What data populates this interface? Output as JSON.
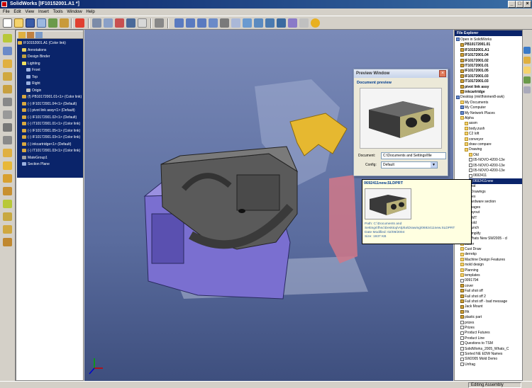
{
  "window": {
    "app_name": "SolidWorks",
    "document_title": "[IF10152001.A1 *]",
    "controls": {
      "minimize": "_",
      "maximize": "□",
      "close": "×"
    }
  },
  "menu": [
    "File",
    "Edit",
    "View",
    "Insert",
    "Tools",
    "Window",
    "Help"
  ],
  "feature_tree": {
    "items": [
      {
        "label": "IF10152001.A1 (Color link)",
        "icon": "assembly-icon",
        "indent": 0
      },
      {
        "label": "Annotations",
        "icon": "annotations-icon",
        "indent": 1
      },
      {
        "label": "Design Binder",
        "icon": "design-binder-icon",
        "indent": 1
      },
      {
        "label": "Lighting",
        "icon": "lighting-icon",
        "indent": 1
      },
      {
        "label": "Front",
        "icon": "plane-icon",
        "indent": 2
      },
      {
        "label": "Top",
        "icon": "plane-icon",
        "indent": 2
      },
      {
        "label": "Right",
        "icon": "plane-icon",
        "indent": 2
      },
      {
        "label": "Origin",
        "icon": "origin-icon",
        "indent": 2
      },
      {
        "label": "(f) PB10172001.01<1> (Color link)",
        "icon": "part-icon",
        "indent": 1
      },
      {
        "label": "(-) IF10172001.04<1> (Default)",
        "icon": "part-icon",
        "indent": 1
      },
      {
        "label": "(-) pivot link assy<1> (Default)",
        "icon": "part-icon",
        "indent": 1
      },
      {
        "label": "(-) IF10172001.02<1> (Default)",
        "icon": "part-icon",
        "indent": 1
      },
      {
        "label": "(-) IT10172001.01<1> (Color link)",
        "icon": "part-icon",
        "indent": 1
      },
      {
        "label": "(-) IF10172001.05<1> (Color link)",
        "icon": "part-icon",
        "indent": 1
      },
      {
        "label": "(-) IF10172001.03<1> (Color link)",
        "icon": "part-icon",
        "indent": 1
      },
      {
        "label": "(-) inkcartridge<1> (Default)",
        "icon": "part-icon",
        "indent": 1
      },
      {
        "label": "(-) IT10172001.03<1> (Color link)",
        "icon": "part-icon",
        "indent": 1
      },
      {
        "label": "MateGroup1",
        "icon": "mates-icon",
        "indent": 1
      },
      {
        "label": "Section Plane",
        "icon": "plane-icon",
        "indent": 1
      }
    ]
  },
  "file_explorer": {
    "title": "File Explorer",
    "items": [
      {
        "label": "Open in SolidWorks",
        "type": "sys",
        "indent": 0,
        "bold": false
      },
      {
        "label": "PB10172001.01",
        "type": "part",
        "indent": 1,
        "bold": true
      },
      {
        "label": "IF10152001.A1",
        "type": "part",
        "indent": 1,
        "bold": true
      },
      {
        "label": "IF10172001.04",
        "type": "part",
        "indent": 1,
        "bold": true
      },
      {
        "label": "IF10172001.02",
        "type": "part",
        "indent": 1,
        "bold": true
      },
      {
        "label": "IT10172001.01",
        "type": "part",
        "indent": 1,
        "bold": true
      },
      {
        "label": "IF10172001.05",
        "type": "part",
        "indent": 1,
        "bold": true
      },
      {
        "label": "IF10172001.03",
        "type": "part",
        "indent": 1,
        "bold": true
      },
      {
        "label": "IT10172001.03",
        "type": "part",
        "indent": 1,
        "bold": true
      },
      {
        "label": "pivot link assy",
        "type": "part",
        "indent": 1,
        "bold": true
      },
      {
        "label": "inkcartridge",
        "type": "part",
        "indent": 1,
        "bold": true
      },
      {
        "label": "Desktop (mk\\fhinmen8-swk)",
        "type": "sys",
        "indent": 0,
        "bold": false
      },
      {
        "label": "My Documents",
        "type": "folder",
        "indent": 1,
        "bold": false
      },
      {
        "label": "My Computer",
        "type": "sys",
        "indent": 1,
        "bold": false
      },
      {
        "label": "My Network Places",
        "type": "sys",
        "indent": 1,
        "bold": false
      },
      {
        "label": "Alpha",
        "type": "folder",
        "indent": 1,
        "bold": false
      },
      {
        "label": "assm",
        "type": "folder",
        "indent": 2,
        "bold": false
      },
      {
        "label": "body.zush",
        "type": "folder",
        "indent": 2,
        "bold": false
      },
      {
        "label": "C2 loft",
        "type": "folder",
        "indent": 2,
        "bold": false
      },
      {
        "label": "conveyor",
        "type": "folder",
        "indent": 2,
        "bold": false
      },
      {
        "label": "draw compare",
        "type": "folder",
        "indent": 2,
        "bold": false
      },
      {
        "label": "Drawing",
        "type": "folder",
        "indent": 2,
        "bold": false
      },
      {
        "label": "Old",
        "type": "folder",
        "indent": 3,
        "bold": false
      },
      {
        "label": "05-NOVO-4200-13e",
        "type": "doc",
        "indent": 3,
        "bold": false
      },
      {
        "label": "05-NOVO-4200-13e",
        "type": "doc",
        "indent": 3,
        "bold": false
      },
      {
        "label": "05-NOVO-4200-13e",
        "type": "doc",
        "indent": 3,
        "bold": false
      },
      {
        "label": "0692411",
        "type": "doc",
        "indent": 3,
        "bold": false
      },
      {
        "label": "0692411new",
        "type": "doc",
        "indent": 3,
        "bold": false
      },
      {
        "label": "Drat",
        "type": "folder",
        "indent": 2,
        "bold": false
      },
      {
        "label": "eDrawings",
        "type": "folder",
        "indent": 2,
        "bold": false
      },
      {
        "label": "Flex",
        "type": "folder",
        "indent": 2,
        "bold": false
      },
      {
        "label": "hardware section",
        "type": "folder",
        "indent": 2,
        "bold": false
      },
      {
        "label": "images",
        "type": "folder",
        "indent": 2,
        "bold": false
      },
      {
        "label": "Layout",
        "type": "folder",
        "indent": 2,
        "bold": false
      },
      {
        "label": "MMT",
        "type": "folder",
        "indent": 2,
        "bold": false
      },
      {
        "label": "Mold",
        "type": "folder",
        "indent": 2,
        "bold": false
      },
      {
        "label": "Punch",
        "type": "folder",
        "indent": 2,
        "bold": false
      },
      {
        "label": "simplify",
        "type": "folder",
        "indent": 2,
        "bold": false
      },
      {
        "label": "Whats New SW2005 - cl",
        "type": "folder",
        "indent": 2,
        "bold": false
      },
      {
        "label": "blister",
        "type": "folder",
        "indent": 1,
        "bold": false
      },
      {
        "label": "Cust Draw",
        "type": "folder",
        "indent": 1,
        "bold": false
      },
      {
        "label": "derrekp",
        "type": "folder",
        "indent": 1,
        "bold": false
      },
      {
        "label": "Machine Design Features",
        "type": "folder",
        "indent": 1,
        "bold": false
      },
      {
        "label": "mold design",
        "type": "folder",
        "indent": 1,
        "bold": false
      },
      {
        "label": "Planning",
        "type": "folder",
        "indent": 1,
        "bold": false
      },
      {
        "label": "templates",
        "type": "folder",
        "indent": 1,
        "bold": false
      },
      {
        "label": "0091794",
        "type": "doc",
        "indent": 1,
        "bold": false
      },
      {
        "label": "cover",
        "type": "part",
        "indent": 1,
        "bold": false
      },
      {
        "label": "Fail shot off",
        "type": "part",
        "indent": 1,
        "bold": false
      },
      {
        "label": "Fail shot off 2",
        "type": "part",
        "indent": 1,
        "bold": false
      },
      {
        "label": "Fail shot off - bad message",
        "type": "part",
        "indent": 1,
        "bold": false
      },
      {
        "label": "Jack Mount",
        "type": "part",
        "indent": 1,
        "bold": false
      },
      {
        "label": "PA",
        "type": "part",
        "indent": 1,
        "bold": false
      },
      {
        "label": "plastic part",
        "type": "part",
        "indent": 1,
        "bold": false
      },
      {
        "label": "prizes",
        "type": "doc",
        "indent": 1,
        "bold": false
      },
      {
        "label": "Prizes",
        "type": "doc",
        "indent": 1,
        "bold": false
      },
      {
        "label": "Product Futures",
        "type": "doc",
        "indent": 1,
        "bold": false
      },
      {
        "label": "Product Line",
        "type": "doc",
        "indent": 1,
        "bold": false
      },
      {
        "label": "Questions to TSM",
        "type": "doc",
        "indent": 1,
        "bold": false
      },
      {
        "label": "SolidWorks_2005_Whats_C",
        "type": "doc",
        "indent": 1,
        "bold": false
      },
      {
        "label": "Sorted NE EDW Names",
        "type": "doc",
        "indent": 1,
        "bold": false
      },
      {
        "label": "SW2005 Mold Demo",
        "type": "doc",
        "indent": 1,
        "bold": false
      },
      {
        "label": "Unfrag",
        "type": "doc",
        "indent": 1,
        "bold": false
      }
    ]
  },
  "preview_window": {
    "title": "Preview Window",
    "close": "×",
    "heading": "Document preview",
    "document_label": "Document:",
    "document_value": "C:\\Documents and Settings\\file",
    "config_label": "Config:",
    "config_value": "Default",
    "config_arrow": "▼"
  },
  "tooltip": {
    "filename": "0692411new.SLDPRT",
    "path": "Path: C:\\Documents and",
    "path2": "Settings\\fhsc\\Desktop\\Alpha\\Drawing\\0692411new.SLDPRT",
    "modified": "Date Modified: 02/09/2004",
    "size": "Size: 1937 KB"
  },
  "status": {
    "mode": "Editing Assembly"
  },
  "colors": {
    "title_bar": "#0a246a",
    "viewport_bg": "#5a6c9e",
    "selection": "#0a246a",
    "housing": "#7a6fd0",
    "cover": "#555555",
    "gold_part": "#e6b830"
  }
}
